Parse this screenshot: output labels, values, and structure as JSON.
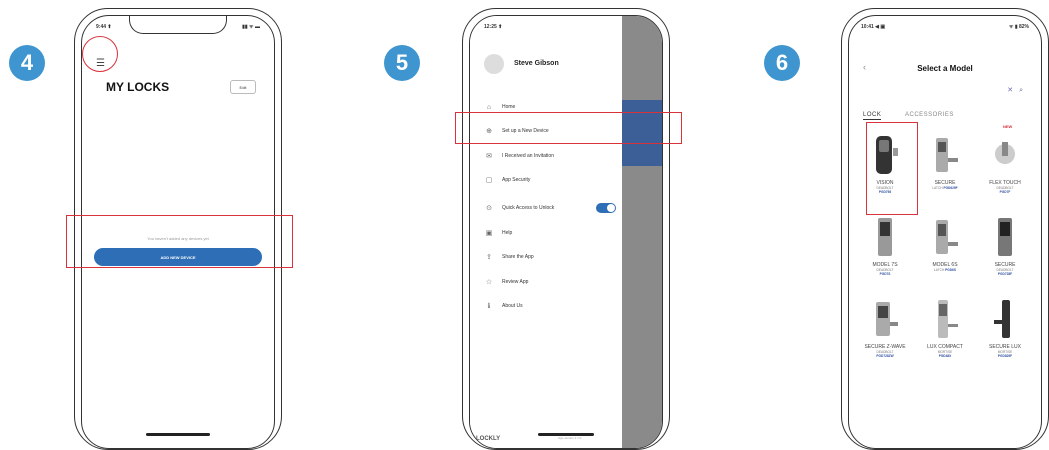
{
  "steps": [
    "4",
    "5",
    "6"
  ],
  "phone4": {
    "status_time": "9:44 ⬆",
    "status_icons": "▮▮ ᯤ ▬",
    "menu_icon": "hamburger-icon",
    "title": "MY LOCKS",
    "edit_label": "Edit",
    "empty_message": "You haven't added any devices yet",
    "add_button": "ADD NEW DEVICE"
  },
  "phone5": {
    "status_time": "12:25 ⬆",
    "user_name": "Steve Gibson",
    "menu_items": [
      {
        "icon": "home-icon",
        "glyph": "⌂",
        "label": "Home"
      },
      {
        "icon": "add-device-icon",
        "glyph": "⊕",
        "label": "Set up a New Device"
      },
      {
        "icon": "invitation-icon",
        "glyph": "✉",
        "label": "I Received an Invitation"
      },
      {
        "icon": "lock-icon",
        "glyph": "🔒︎",
        "label": "App Security"
      },
      {
        "icon": "quick-access-icon",
        "glyph": "⊙",
        "label": "Quick Access to Unlock"
      },
      {
        "icon": "help-icon",
        "glyph": "?",
        "label": "Help"
      },
      {
        "icon": "share-icon",
        "glyph": "⇪",
        "label": "Share the App"
      },
      {
        "icon": "review-icon",
        "glyph": "☆",
        "label": "Review App"
      },
      {
        "icon": "about-icon",
        "glyph": "ℹ",
        "label": "About Us"
      }
    ],
    "logo": "LOCKLY",
    "version": "App version 1.7.0"
  },
  "phone6": {
    "status_time": "10:41 ◀ ▣",
    "status_icons": "ᯤ ▮ 82%",
    "title": "Select a Model",
    "tabs": [
      "LOCK",
      "ACCESSORIES"
    ],
    "new_badge": "NEW",
    "products": [
      {
        "name": "VISION",
        "type": "DEADBOLT",
        "code": "PGD798"
      },
      {
        "name": "SECURE",
        "type": "LATCH",
        "code": "PGD629F"
      },
      {
        "name": "FLEX TOUCH",
        "type": "DEADBOLT",
        "code": "PGD7F"
      },
      {
        "name": "MODEL 7S",
        "type": "DEADBOLT",
        "code": "PGD7S"
      },
      {
        "name": "MODEL 6S",
        "type": "LATCH",
        "code": "PGD6S"
      },
      {
        "name": "SECURE",
        "type": "DEADBOLT",
        "code": "PGD728F"
      },
      {
        "name": "SECURE Z-WAVE",
        "type": "DEADBOLT",
        "code": "PGD728ZW"
      },
      {
        "name": "LUX COMPACT",
        "type": "MORTISE",
        "code": "PGD48X"
      },
      {
        "name": "SECURE LUX",
        "type": "MORTISE",
        "code": "PGD829F"
      }
    ]
  },
  "colors": {
    "accent": "#3f95cf",
    "button": "#2d6eb6",
    "highlight": "#d8323a"
  }
}
